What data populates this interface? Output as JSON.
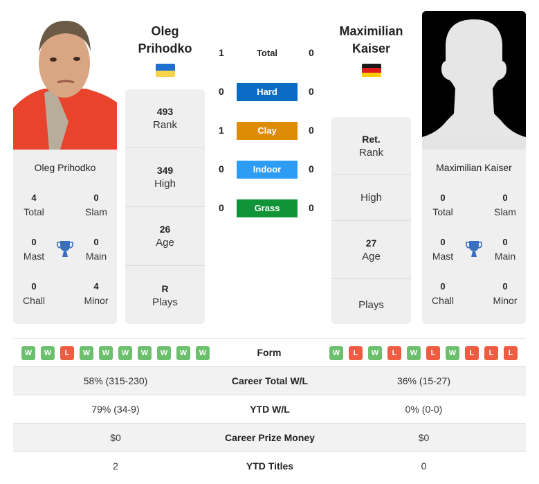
{
  "player1": {
    "name_line1": "Oleg",
    "name_line2": "Prihodko",
    "full_name": "Oleg Prihodko",
    "country": "Ukraine",
    "flag_colors": [
      "#1f6fd0",
      "#f7d44a"
    ],
    "titles": {
      "total": {
        "value": "4",
        "label": "Total"
      },
      "slam": {
        "value": "0",
        "label": "Slam"
      },
      "mast": {
        "value": "0",
        "label": "Mast"
      },
      "main": {
        "value": "0",
        "label": "Main"
      },
      "chall": {
        "value": "0",
        "label": "Chall"
      },
      "minor": {
        "value": "4",
        "label": "Minor"
      }
    },
    "info": [
      {
        "value": "493",
        "label": "Rank"
      },
      {
        "value": "349",
        "label": "High"
      },
      {
        "value": "26",
        "label": "Age"
      },
      {
        "value": "R",
        "label": "Plays"
      }
    ],
    "form": [
      "W",
      "W",
      "L",
      "W",
      "W",
      "W",
      "W",
      "W",
      "W",
      "W"
    ]
  },
  "player2": {
    "name_line1": "Maximilian",
    "name_line2": "Kaiser",
    "full_name": "Maximilian Kaiser",
    "country": "Germany",
    "flag_colors": [
      "#1a1a1a",
      "#dd1c1c",
      "#ffce00"
    ],
    "titles": {
      "total": {
        "value": "0",
        "label": "Total"
      },
      "slam": {
        "value": "0",
        "label": "Slam"
      },
      "mast": {
        "value": "0",
        "label": "Mast"
      },
      "main": {
        "value": "0",
        "label": "Main"
      },
      "chall": {
        "value": "0",
        "label": "Chall"
      },
      "minor": {
        "value": "0",
        "label": "Minor"
      }
    },
    "info": [
      {
        "value": "Ret.",
        "label": "Rank"
      },
      {
        "value": "",
        "label": "High"
      },
      {
        "value": "27",
        "label": "Age"
      },
      {
        "value": "",
        "label": "Plays"
      }
    ],
    "form": [
      "W",
      "L",
      "W",
      "L",
      "W",
      "L",
      "W",
      "L",
      "L",
      "L"
    ]
  },
  "h2h": [
    {
      "label": "Total",
      "p1": "1",
      "p2": "0",
      "color": ""
    },
    {
      "label": "Hard",
      "p1": "0",
      "p2": "0",
      "color": "#0a6cc4"
    },
    {
      "label": "Clay",
      "p1": "1",
      "p2": "0",
      "color": "#de8b05"
    },
    {
      "label": "Indoor",
      "p1": "0",
      "p2": "0",
      "color": "#2d9cf5"
    },
    {
      "label": "Grass",
      "p1": "0",
      "p2": "0",
      "color": "#109438"
    }
  ],
  "form_label": "Form",
  "stats": [
    {
      "label": "Career Total W/L",
      "p1": "58% (315-230)",
      "p2": "36% (15-27)"
    },
    {
      "label": "YTD W/L",
      "p1": "79% (34-9)",
      "p2": "0% (0-0)"
    },
    {
      "label": "Career Prize Money",
      "p1": "$0",
      "p2": "$0"
    },
    {
      "label": "YTD Titles",
      "p1": "2",
      "p2": "0"
    }
  ],
  "colors": {
    "win": "#6cbf6c",
    "loss": "#ee5c42",
    "trophy": "#3a6fbf",
    "card_bg": "#efefef"
  }
}
